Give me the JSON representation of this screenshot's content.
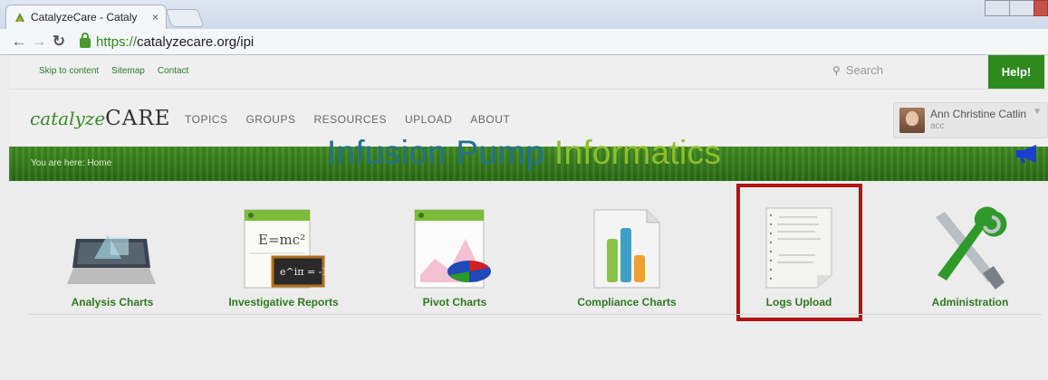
{
  "browser": {
    "tab_title": "CatalyzeCare - Cataly",
    "tab_close": "×",
    "url_scheme": "https://",
    "url_rest": "catalyzecare.org/ipi"
  },
  "utility": {
    "links": [
      "Skip to content",
      "Sitemap",
      "Contact"
    ],
    "search_placeholder": "Search",
    "help_label": "Help!"
  },
  "header": {
    "logo_part1": "catalyze",
    "logo_part2": "CARE",
    "nav": [
      "TOPICS",
      "GROUPS",
      "RESOURCES",
      "UPLOAD",
      "ABOUT"
    ],
    "user_name": "Ann Christine Catlin",
    "user_id": "acc"
  },
  "breadcrumb": "You are here: Home",
  "title": {
    "part1": "Infusion Pump",
    "part2": "Informatics"
  },
  "tiles": [
    {
      "label": "Analysis Charts",
      "icon": "analysis-charts-icon"
    },
    {
      "label": "Investigative Reports",
      "icon": "investigative-reports-icon"
    },
    {
      "label": "Pivot Charts",
      "icon": "pivot-charts-icon"
    },
    {
      "label": "Compliance Charts",
      "icon": "compliance-charts-icon"
    },
    {
      "label": "Logs Upload",
      "icon": "logs-upload-icon"
    },
    {
      "label": "Administration",
      "icon": "administration-icon"
    }
  ],
  "colors": {
    "brand_green": "#2f8a1e",
    "title_blue": "#23728a",
    "title_lime": "#8fbf2c",
    "highlight_red": "#b31313"
  }
}
